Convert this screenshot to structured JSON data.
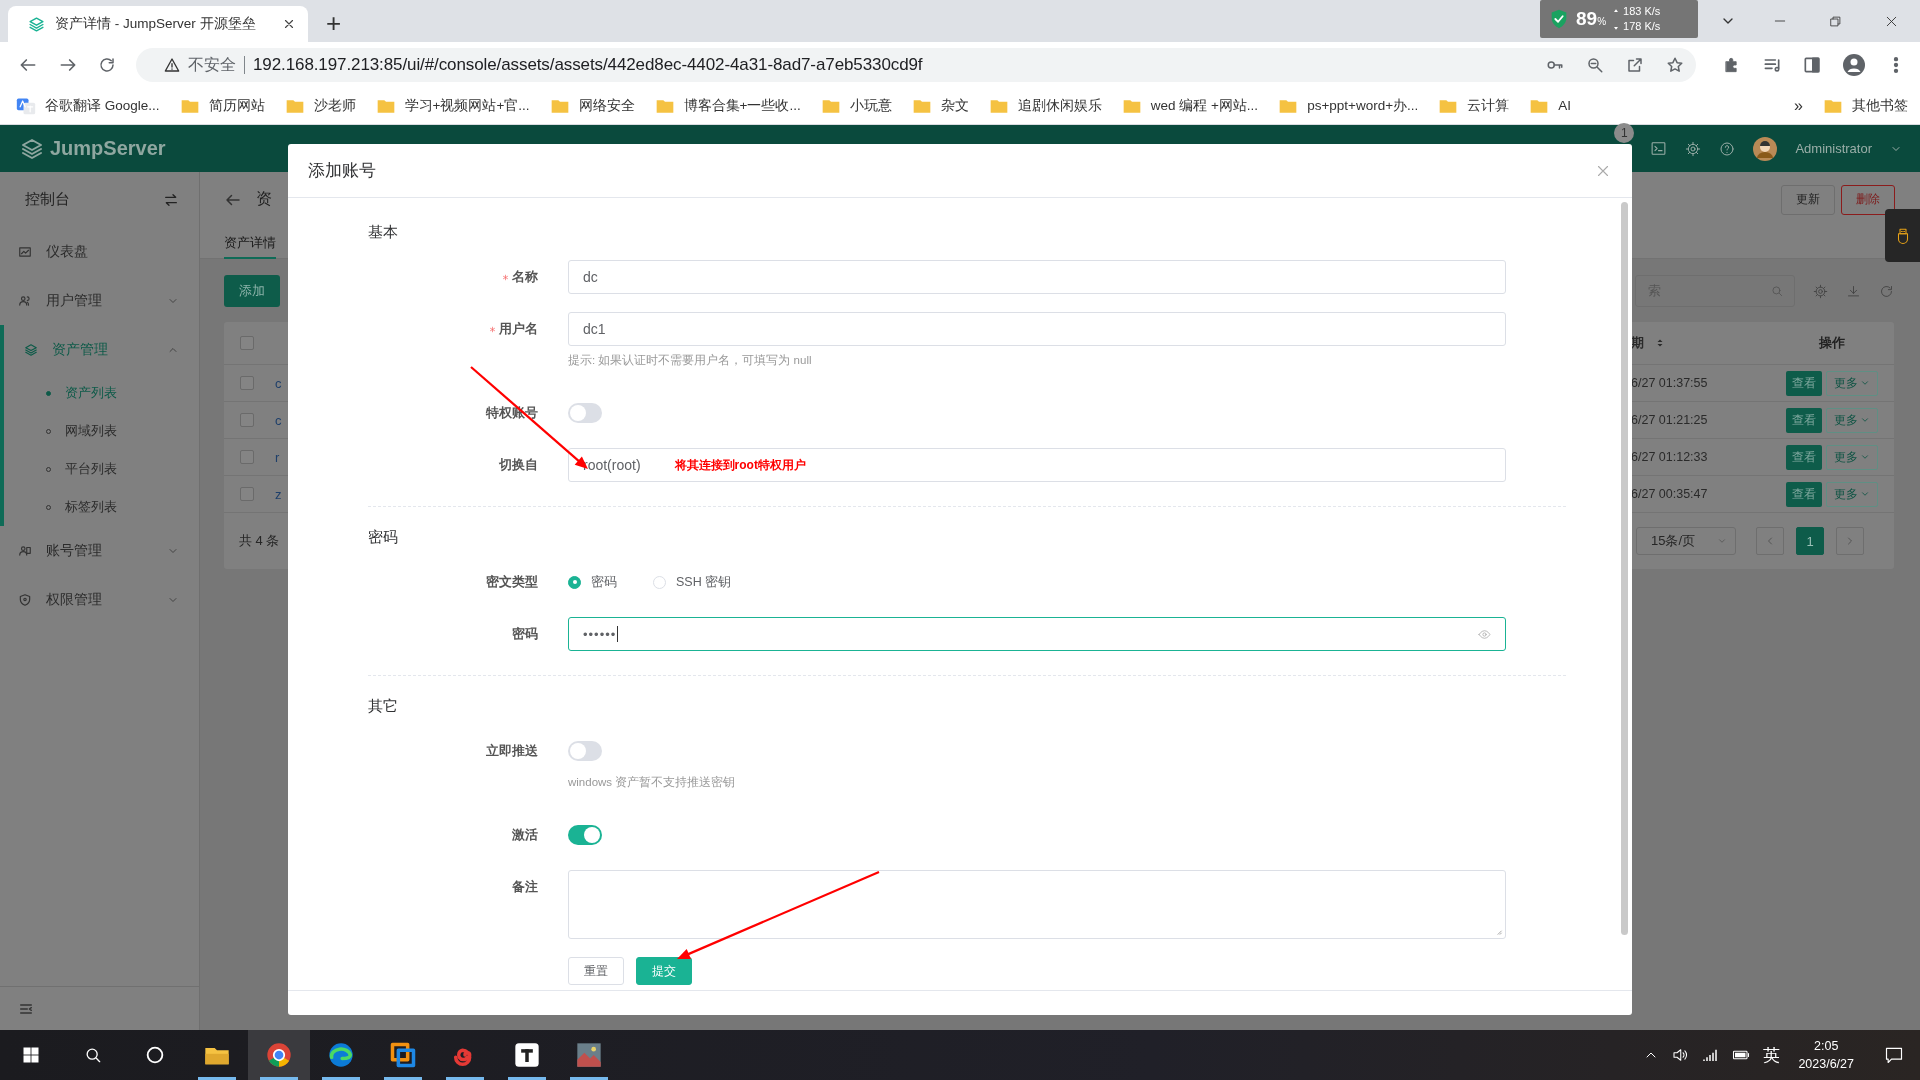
{
  "browser": {
    "tab_title": "资产详情 - JumpServer 开源堡垒",
    "new_tab": "+",
    "monitor": {
      "percent": "89",
      "unit": "%",
      "upload": "183 K/s",
      "download": "178 K/s"
    },
    "security": "不安全",
    "url": "192.168.197.213:85/ui/#/console/assets/assets/442ed8ec-4402-4a31-8ad7-a7eb5330cd9f",
    "bookmarks": [
      {
        "kind": "app",
        "label": "谷歌翻译 Google..."
      },
      {
        "kind": "folder",
        "label": "简历网站"
      },
      {
        "kind": "folder",
        "label": "沙老师"
      },
      {
        "kind": "folder",
        "label": "学习+视频网站+官..."
      },
      {
        "kind": "folder",
        "label": "网络安全"
      },
      {
        "kind": "folder",
        "label": "博客合集+一些收..."
      },
      {
        "kind": "folder",
        "label": "小玩意"
      },
      {
        "kind": "folder",
        "label": "杂文"
      },
      {
        "kind": "folder",
        "label": "追剧休闲娱乐"
      },
      {
        "kind": "folder",
        "label": "wed 编程 +网站..."
      },
      {
        "kind": "folder",
        "label": "ps+ppt+word+办..."
      },
      {
        "kind": "folder",
        "label": "云计算"
      },
      {
        "kind": "folder",
        "label": "AI"
      }
    ],
    "more_bookmarks": "»",
    "other_bookmarks": "其他书签"
  },
  "app": {
    "logo": "JumpServer",
    "badge": "1",
    "user": "Administrator"
  },
  "sidebar": {
    "title": "控制台",
    "items": [
      {
        "kind": "link",
        "label": "仪表盘",
        "selected": false
      },
      {
        "kind": "group",
        "label": "用户管理",
        "selected": false,
        "expanded": false
      },
      {
        "kind": "group",
        "label": "资产管理",
        "selected": true,
        "expanded": true,
        "children": [
          {
            "label": "资产列表",
            "selected": true
          },
          {
            "label": "网域列表",
            "selected": false
          },
          {
            "label": "平台列表",
            "selected": false
          },
          {
            "label": "标签列表",
            "selected": false
          }
        ]
      },
      {
        "kind": "group",
        "label": "账号管理",
        "selected": false,
        "expanded": false
      },
      {
        "kind": "group",
        "label": "权限管理",
        "selected": false,
        "expanded": false
      }
    ]
  },
  "main": {
    "title": "资",
    "tabs": [
      {
        "label": "资产详情",
        "selected": true
      }
    ],
    "update_button": "更新",
    "delete_button": "删除",
    "add_button": "添加",
    "search_placeholder": "索",
    "select_all_checked": false,
    "date_column": "期",
    "actions_column": "操作",
    "rows": [
      {
        "checked": false,
        "name": "c",
        "date": "6/27 01:37:55",
        "view": "查看",
        "more": "更多"
      },
      {
        "checked": false,
        "name": "c",
        "date": "6/27 01:21:25",
        "view": "查看",
        "more": "更多"
      },
      {
        "checked": false,
        "name": "r",
        "date": "6/27 01:12:33",
        "view": "查看",
        "more": "更多"
      },
      {
        "checked": false,
        "name": "z",
        "date": "6/27 00:35:47",
        "view": "查看",
        "more": "更多"
      }
    ],
    "total": "共 4 条",
    "page_size": "15条/页",
    "pages": [
      {
        "label": "1",
        "selected": true
      }
    ]
  },
  "modal": {
    "title": "添加账号",
    "sections": [
      {
        "title": "基本",
        "fields": [
          {
            "kind": "text",
            "label": "名称",
            "required": true,
            "value": "dc"
          },
          {
            "kind": "text",
            "label": "用户名",
            "required": true,
            "value": "dc1",
            "hint": "提示: 如果认证时不需要用户名，可填写为 null"
          },
          {
            "kind": "switch",
            "label": "特权账号",
            "on": false
          },
          {
            "kind": "text",
            "label": "切换自",
            "value": "root(root)",
            "annotation": "将其连接到root特权用户"
          }
        ]
      },
      {
        "title": "密码",
        "fields": [
          {
            "kind": "radio",
            "label": "密文类型",
            "options": [
              {
                "label": "密码",
                "selected": true
              },
              {
                "label": "SSH 密钥",
                "selected": false
              }
            ]
          },
          {
            "kind": "password",
            "label": "密码",
            "value": "••••••",
            "focused": true
          }
        ]
      },
      {
        "title": "其它",
        "fields": [
          {
            "kind": "switch",
            "label": "立即推送",
            "on": false,
            "hint": "windows 资产暂不支持推送密钥"
          },
          {
            "kind": "switch",
            "label": "激活",
            "on": true
          },
          {
            "kind": "textarea",
            "label": "备注"
          }
        ]
      }
    ],
    "buttons": [
      {
        "kind": "default",
        "label": "重置"
      },
      {
        "kind": "primary",
        "label": "提交"
      }
    ]
  },
  "taskbar": {
    "ime": "英",
    "time": "2:05",
    "date": "2023/6/27"
  }
}
